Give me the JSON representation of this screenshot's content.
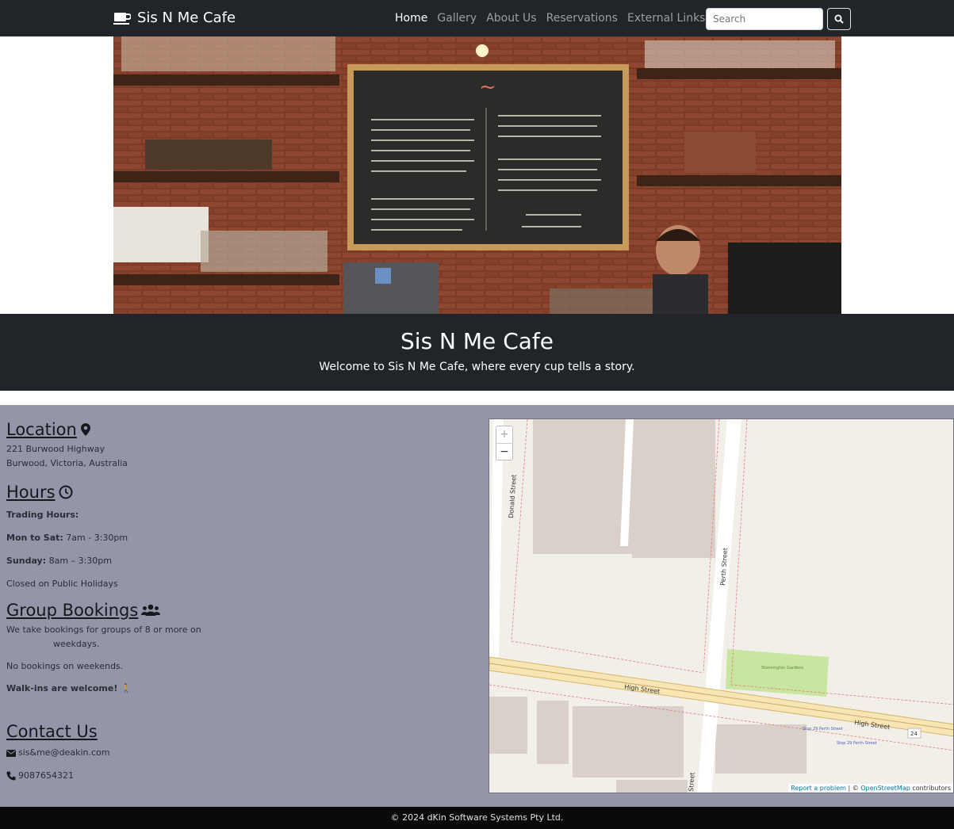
{
  "nav": {
    "brand": "Sis N Me Cafe",
    "links": [
      "Home",
      "Gallery",
      "About Us",
      "Reservations",
      "External Links"
    ],
    "search_placeholder": "Search"
  },
  "hero": {
    "title": "Sis N Me Cafe",
    "subtitle": "Welcome to Sis N Me Cafe, where every cup tells a story."
  },
  "location": {
    "heading": "Location",
    "line1": "221 Burwood Highway",
    "line2": "Burwood, Victoria, Australia"
  },
  "hours": {
    "heading": "Hours",
    "trading": "Trading Hours:",
    "mon_sat_label": "Mon to Sat:",
    "mon_sat_value": " 7am - 3:30pm",
    "sunday_label": "Sunday:",
    "sunday_value": " 8am – 3:30pm",
    "holidays": "Closed on Public Holidays"
  },
  "group": {
    "heading": "Group Bookings",
    "line1": "We take bookings for groups of 8 or more on",
    "line2": "weekdays.",
    "line3": "No bookings on weekends.",
    "walkins": "Walk-ins are welcome! 🚶"
  },
  "contact": {
    "heading": "Contact Us",
    "email": "sis&me@deakin.com",
    "phone": "9087654321"
  },
  "map": {
    "zoom_in": "+",
    "zoom_out": "−",
    "streets": [
      "Donald Street",
      "Perth Street",
      "High Street",
      "High Street",
      "Street"
    ],
    "park": "Stonnington Gardens",
    "stop1": "Stop 29 Perth Street",
    "stop2": "Stop 29 Perth Street",
    "route": "24",
    "attrib_report": "Report a problem",
    "attrib_osm": "OpenStreetMap",
    "attrib_rest": " contributors"
  },
  "footer": {
    "text": "© 2024 dKin Software Systems Pty Ltd."
  }
}
